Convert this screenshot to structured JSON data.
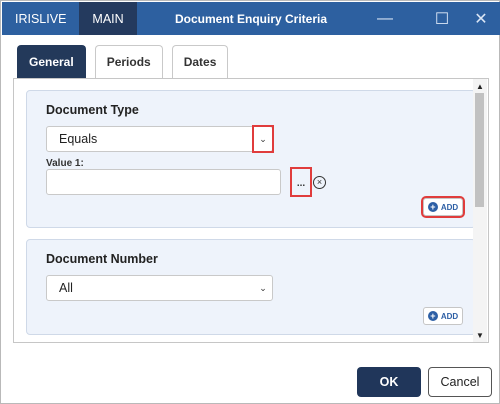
{
  "titlebar": {
    "tabs": [
      "IRISLIVE",
      "MAIN"
    ],
    "active_tab": "MAIN",
    "title": "Document Enquiry Criteria",
    "minimize_glyph": "—",
    "maximize_glyph": "☐",
    "close_glyph": "✕"
  },
  "tabs": [
    {
      "label": "General",
      "active": true
    },
    {
      "label": "Periods",
      "active": false
    },
    {
      "label": "Dates",
      "active": false
    }
  ],
  "document_type": {
    "title": "Document Type",
    "operator": "Equals",
    "value_label": "Value 1:",
    "value": "",
    "lookup_label": "...",
    "add_label": "ADD"
  },
  "document_number": {
    "title": "Document Number",
    "operator": "All",
    "add_label": "ADD"
  },
  "footer": {
    "ok_label": "OK",
    "cancel_label": "Cancel"
  },
  "colors": {
    "titlebar": "#2d60a0",
    "active_tab": "#23395a",
    "highlight": "#e03c3c"
  }
}
